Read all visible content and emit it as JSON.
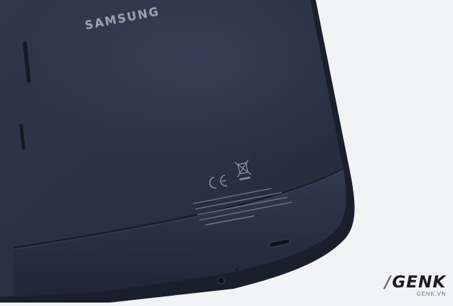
{
  "phone": {
    "brand_text": "SAMSUNG",
    "body_color": "#2a3143",
    "edge_color": "#1c2231",
    "regulatory_marks": [
      "ce-mark",
      "weee-crossed-bin"
    ]
  },
  "watermark": {
    "logo": "GENK",
    "url": "GENK.VN"
  },
  "colors": {
    "background": "#f2f3f5",
    "brand_print": "#9aa1ad"
  }
}
